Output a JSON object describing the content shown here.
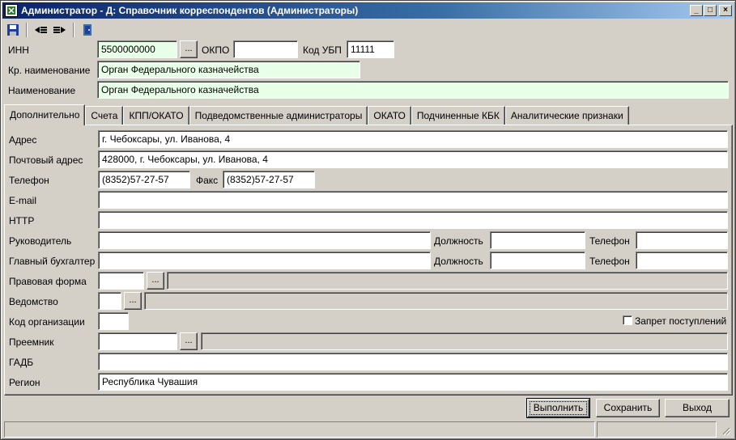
{
  "window": {
    "title": "Администратор - Д: Справочник корреспондентов (Администраторы)",
    "min_glyph": "_",
    "max_glyph": "□",
    "close_glyph": "×"
  },
  "toolbar": {
    "icons": [
      "save-icon",
      "move-left-icon",
      "move-right-icon",
      "exit-icon"
    ]
  },
  "header": {
    "inn_label": "ИНН",
    "inn_value": "5500000000",
    "okpo_label": "ОКПО",
    "okpo_value": "",
    "kod_ubp_label": "Код УБП",
    "kod_ubp_value": "11111",
    "short_name_label": "Кр. наименование",
    "short_name_value": "Орган Федерального казначейства",
    "name_label": "Наименование",
    "name_value": "Орган Федерального казначейства",
    "dots": "..."
  },
  "tabs": [
    {
      "label": "Дополнительно"
    },
    {
      "label": "Счета"
    },
    {
      "label": "КПП/ОКАТО"
    },
    {
      "label": "Подведомственные администраторы"
    },
    {
      "label": "ОКАТО"
    },
    {
      "label": "Подчиненные КБК"
    },
    {
      "label": "Аналитические признаки"
    }
  ],
  "form": {
    "address_label": "Адрес",
    "address_value": "г. Чебоксары, ул. Иванова, 4",
    "postal_label": "Почтовый адрес",
    "postal_value": "428000, г. Чебоксары, ул. Иванова, 4",
    "phone_label": "Телефон",
    "phone_value": "(8352)57-27-57",
    "fax_label": "Факс",
    "fax_value": "(8352)57-27-57",
    "email_label": "E-mail",
    "email_value": "",
    "http_label": "HTTP",
    "http_value": "",
    "head_label": "Руководитель",
    "head_value": "",
    "head_position_label": "Должность",
    "head_position_value": "",
    "head_phone_label": "Телефон",
    "head_phone_value": "",
    "accountant_label": "Главный бухгалтер",
    "accountant_value": "",
    "accountant_position_label": "Должность",
    "accountant_position_value": "",
    "accountant_phone_label": "Телефон",
    "accountant_phone_value": "",
    "legal_form_label": "Правовая форма",
    "department_label": "Ведомство",
    "org_code_label": "Код организации",
    "ban_label": "Запрет поступлений",
    "successor_label": "Преемник",
    "gadb_label": "ГАДБ",
    "gadb_value": "",
    "region_label": "Регион",
    "region_value": "Республика Чувашия"
  },
  "buttons": {
    "execute": "Выполнить",
    "save": "Сохранить",
    "exit": "Выход"
  }
}
